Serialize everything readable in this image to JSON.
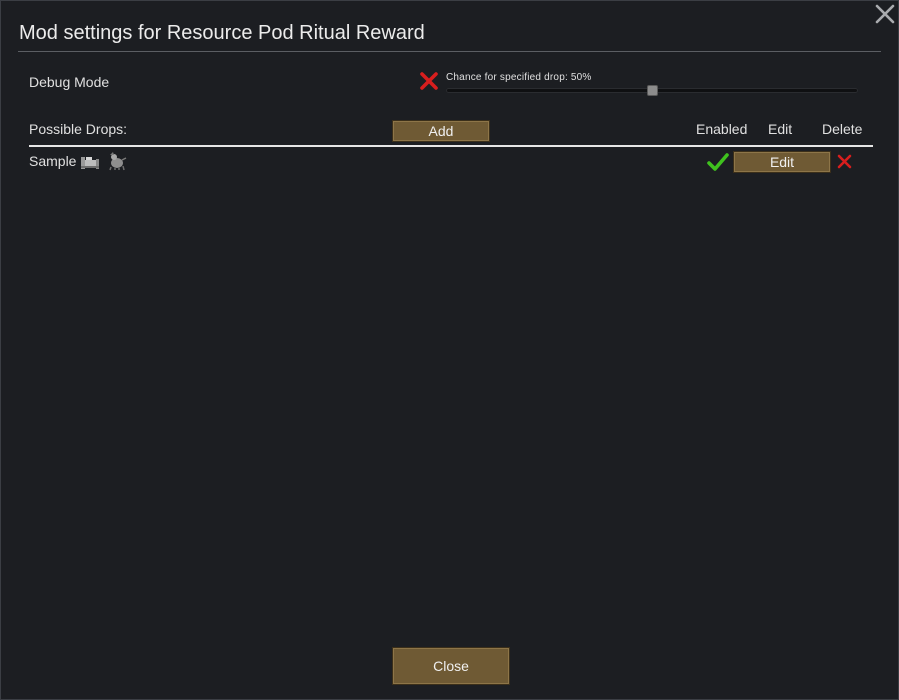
{
  "window": {
    "title": "Mod settings for Resource Pod Ritual Reward",
    "close_icon": "close-x-icon"
  },
  "settings": {
    "debug_mode_label": "Debug Mode",
    "debug_mode_enabled": false,
    "slider": {
      "label": "Chance for specified drop: 50%",
      "value_percent": 50
    }
  },
  "drops": {
    "label": "Possible Drops:",
    "add_label": "Add",
    "columns": [
      "Enabled",
      "Edit",
      "Delete"
    ],
    "rows": [
      {
        "name": "Sample",
        "icons": [
          "bed-furniture-icon",
          "animal-creature-icon"
        ],
        "enabled": true,
        "edit_label": "Edit"
      }
    ]
  },
  "footer": {
    "close_label": "Close"
  },
  "colors": {
    "background": "#1c1e22",
    "button": "#6f5a34",
    "check": "#3fc21e",
    "cross": "#d81e1e"
  }
}
